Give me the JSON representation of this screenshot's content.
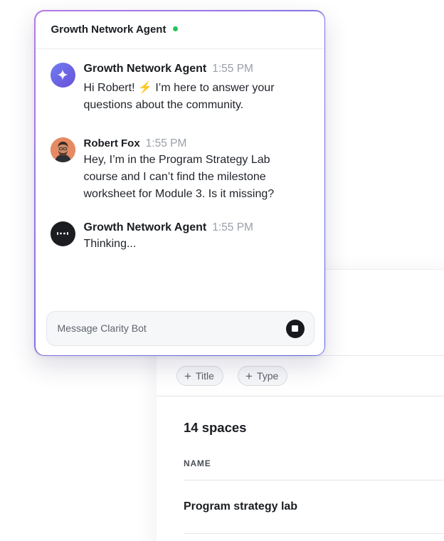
{
  "chat": {
    "title": "Growth Network Agent",
    "status_color": "#22c55e",
    "messages": [
      {
        "sender": "Growth Network Agent",
        "time": "1:55 PM",
        "text_before": "Hi Robert! ",
        "emoji": "⚡",
        "text_after": " I’m here to answer your questions about the community.",
        "avatar_icon": "sparkle-icon"
      },
      {
        "sender": "Robert Fox",
        "time": "1:55 PM",
        "text": "Hey, I’m in the Program Strategy Lab course and I can’t find the milestone worksheet for Module 3. Is it missing?",
        "avatar_icon": "user-avatar"
      },
      {
        "sender": "Growth Network Agent",
        "time": "1:55 PM",
        "text": "Thinking...",
        "avatar_icon": "bot-icon"
      }
    ],
    "composer": {
      "placeholder": "Message Clarity Bot",
      "stop_icon": "stop-icon"
    }
  },
  "page": {
    "filters": [
      {
        "label": "Title",
        "icon": "plus-icon"
      },
      {
        "label": "Type",
        "icon": "plus-icon"
      }
    ],
    "spaces_count": "14 spaces",
    "column_header": "NAME",
    "rows": [
      {
        "name": "Program strategy lab"
      }
    ]
  }
}
